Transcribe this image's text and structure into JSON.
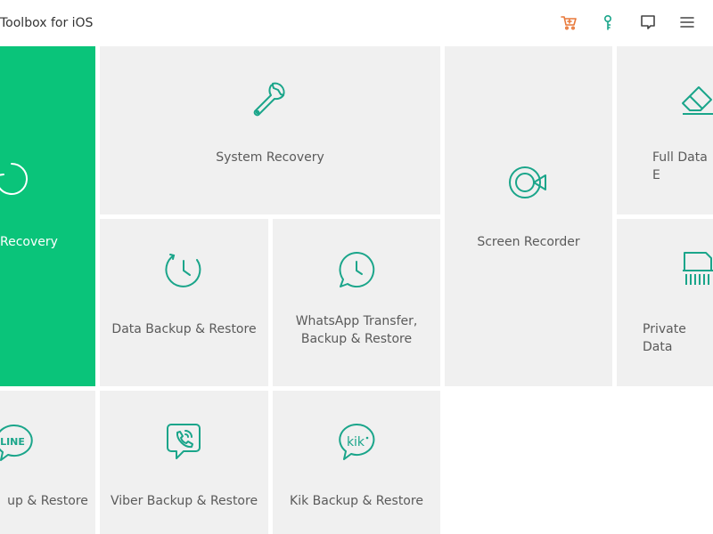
{
  "window": {
    "title": "Toolbox for iOS"
  },
  "toolbar": {
    "icons": [
      "cart-icon",
      "key-icon",
      "feedback-icon",
      "menu-icon"
    ],
    "cart_color": "#e8793a",
    "accent_color": "#1aa58a"
  },
  "tiles": {
    "data_recovery": {
      "label": "Recovery"
    },
    "system_recovery": {
      "label": "System Recovery"
    },
    "screen_recorder": {
      "label": "Screen Recorder"
    },
    "full_data_eraser": {
      "label": "Full Data E"
    },
    "data_backup": {
      "label": "Data Backup & Restore"
    },
    "whatsapp": {
      "label": "WhatsApp Transfer,\nBackup & Restore"
    },
    "private_data": {
      "label": "Private Data"
    },
    "line_backup": {
      "label": "up & Restore"
    },
    "viber_backup": {
      "label": "Viber Backup & Restore"
    },
    "kik_backup": {
      "label": "Kik Backup & Restore"
    }
  },
  "colors": {
    "tile_bg": "#f0f0f0",
    "highlight": "#0ac47a",
    "icon": "#1aa58a"
  }
}
